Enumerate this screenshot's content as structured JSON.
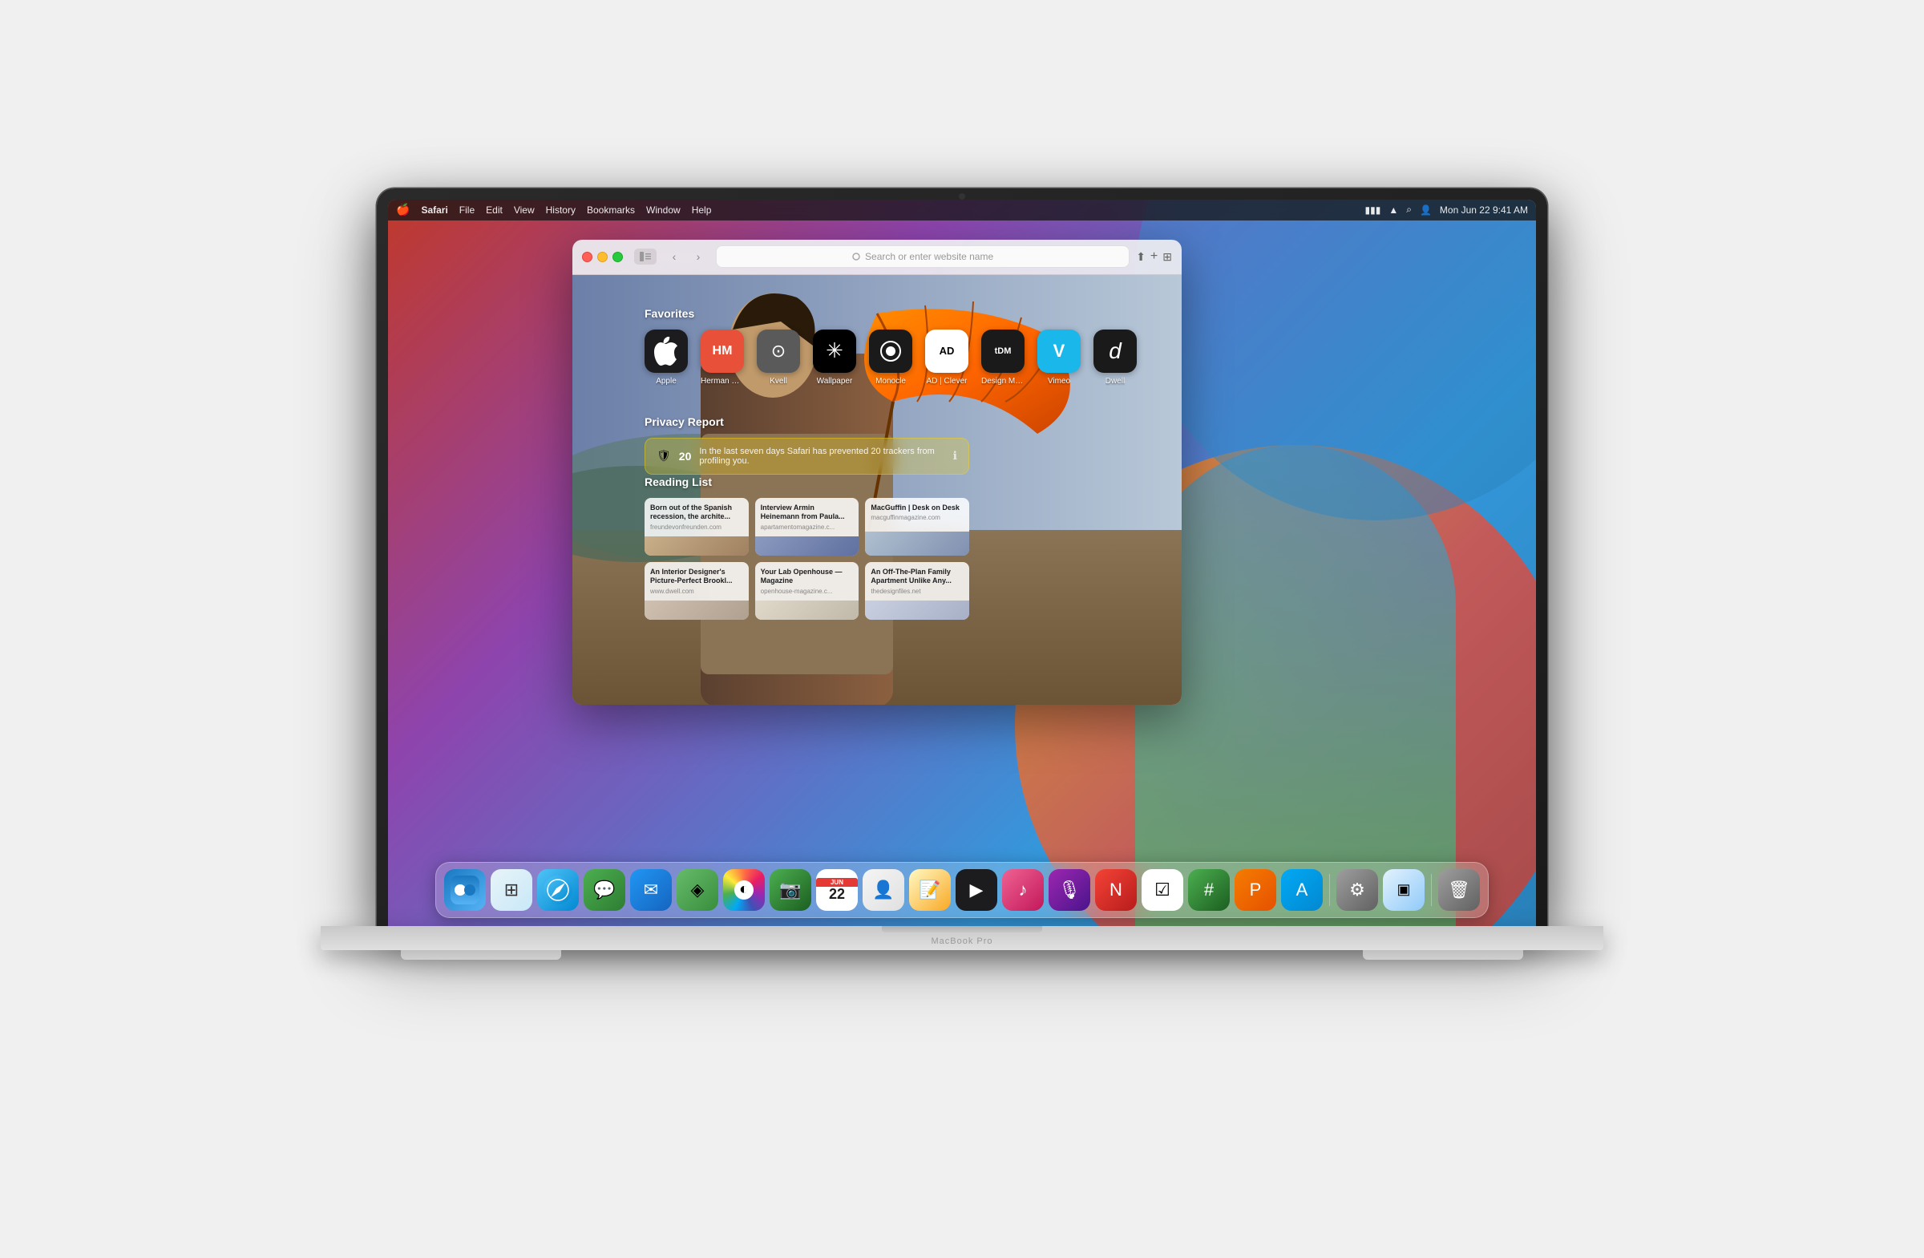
{
  "macbook": {
    "model_label": "MacBook Pro"
  },
  "menu_bar": {
    "apple_symbol": "🍎",
    "app_name": "Safari",
    "menus": [
      "File",
      "Edit",
      "View",
      "History",
      "Bookmarks",
      "Window",
      "Help"
    ],
    "right_items": {
      "battery_icon": "▮▮▮",
      "wifi_icon": "wifi",
      "search_icon": "search",
      "time": "Mon Jun 22  9:41 AM"
    }
  },
  "safari": {
    "toolbar": {
      "back_label": "‹",
      "forward_label": "›",
      "address_placeholder": "Search or enter website name",
      "share_icon": "share",
      "new_tab_icon": "+",
      "extensions_icon": "ext"
    },
    "newtab": {
      "favorites_title": "Favorites",
      "favorites": [
        {
          "label": "Apple",
          "bg": "#1c1c1e",
          "symbol": "🍎",
          "style": "apple"
        },
        {
          "label": "Herman Miller",
          "bg": "#e8503a",
          "symbol": "HM",
          "style": "herman"
        },
        {
          "label": "Kvell",
          "bg": "#5a5a5a",
          "symbol": "⊙",
          "style": "kvell"
        },
        {
          "label": "Wallpaper",
          "bg": "#000",
          "symbol": "✳",
          "style": "wallpaper"
        },
        {
          "label": "Monocle",
          "bg": "#1a1a1a",
          "symbol": "⊛",
          "style": "monocle"
        },
        {
          "label": "AD | Clever",
          "bg": "#fff",
          "symbol": "AD",
          "style": "ad"
        },
        {
          "label": "Design Museum",
          "bg": "#1a1a1a",
          "symbol": "tDM",
          "style": "tdm"
        },
        {
          "label": "Vimeo",
          "bg": "#1ab7ea",
          "symbol": "V",
          "style": "vimeo"
        },
        {
          "label": "Dwell",
          "bg": "#1a1a1a",
          "symbol": "d",
          "style": "dwell"
        }
      ],
      "privacy_title": "Privacy Report",
      "privacy_count": "20",
      "privacy_text": "In the last seven days Safari has prevented 20 trackers from profiling you.",
      "reading_title": "Reading List",
      "reading_items": [
        {
          "title": "Born out of the Spanish recession, the archite...",
          "url": "freundevonfreunden.com",
          "thumb_style": "reading-thumb-1"
        },
        {
          "title": "Interview Armin Heinemann from Paula...",
          "url": "apartamentomagazine.c...",
          "thumb_style": "reading-thumb-2"
        },
        {
          "title": "MacGuffin | Desk on Desk",
          "url": "macguffinmagazine.com",
          "thumb_style": "reading-thumb-3"
        },
        {
          "title": "An Interior Designer's Picture-Perfect Brookl...",
          "url": "www.dwell.com",
          "thumb_style": "reading-thumb-4"
        },
        {
          "title": "Your Lab Openhouse — Magazine",
          "url": "openhouse-magazine.c...",
          "thumb_style": "reading-thumb-5"
        },
        {
          "title": "An Off-The-Plan Family Apartment Unlike Any...",
          "url": "thedesignfiles.net",
          "thumb_style": "reading-thumb-6"
        }
      ]
    }
  },
  "dock": {
    "icons": [
      {
        "name": "Finder",
        "style": "di-finder",
        "symbol": "◉"
      },
      {
        "name": "Launchpad",
        "style": "di-launchpad",
        "symbol": "⊞"
      },
      {
        "name": "Safari",
        "style": "di-safari",
        "symbol": "◎"
      },
      {
        "name": "Messages",
        "style": "di-messages",
        "symbol": "💬"
      },
      {
        "name": "Mail",
        "style": "di-mail",
        "symbol": "✉"
      },
      {
        "name": "Maps",
        "style": "di-maps",
        "symbol": "◈"
      },
      {
        "name": "Photos",
        "style": "di-photos",
        "symbol": "◐"
      },
      {
        "name": "FaceTime",
        "style": "di-facetime",
        "symbol": "📷"
      },
      {
        "name": "Calendar",
        "style": "di-calendar",
        "symbol": "22"
      },
      {
        "name": "Contacts",
        "style": "di-contacts",
        "symbol": "👤"
      },
      {
        "name": "Notes",
        "style": "di-notes",
        "symbol": "📝"
      },
      {
        "name": "Apple TV",
        "style": "di-appletv",
        "symbol": "▶"
      },
      {
        "name": "Music",
        "style": "di-music",
        "symbol": "♪"
      },
      {
        "name": "Podcasts",
        "style": "di-podcasts",
        "symbol": "🎙"
      },
      {
        "name": "News",
        "style": "di-news",
        "symbol": "N"
      },
      {
        "name": "Reminders",
        "style": "di-reminders",
        "symbol": "☑"
      },
      {
        "name": "Numbers",
        "style": "di-numbers",
        "symbol": "#"
      },
      {
        "name": "Pages",
        "style": "di-pages",
        "symbol": "P"
      },
      {
        "name": "App Store",
        "style": "di-appstore",
        "symbol": "A"
      },
      {
        "name": "System Preferences",
        "style": "di-settings",
        "symbol": "⚙"
      },
      {
        "name": "Mission Control",
        "style": "di-multitasking",
        "symbol": "▣"
      },
      {
        "name": "Trash",
        "style": "di-trash",
        "symbol": "🗑"
      }
    ]
  }
}
